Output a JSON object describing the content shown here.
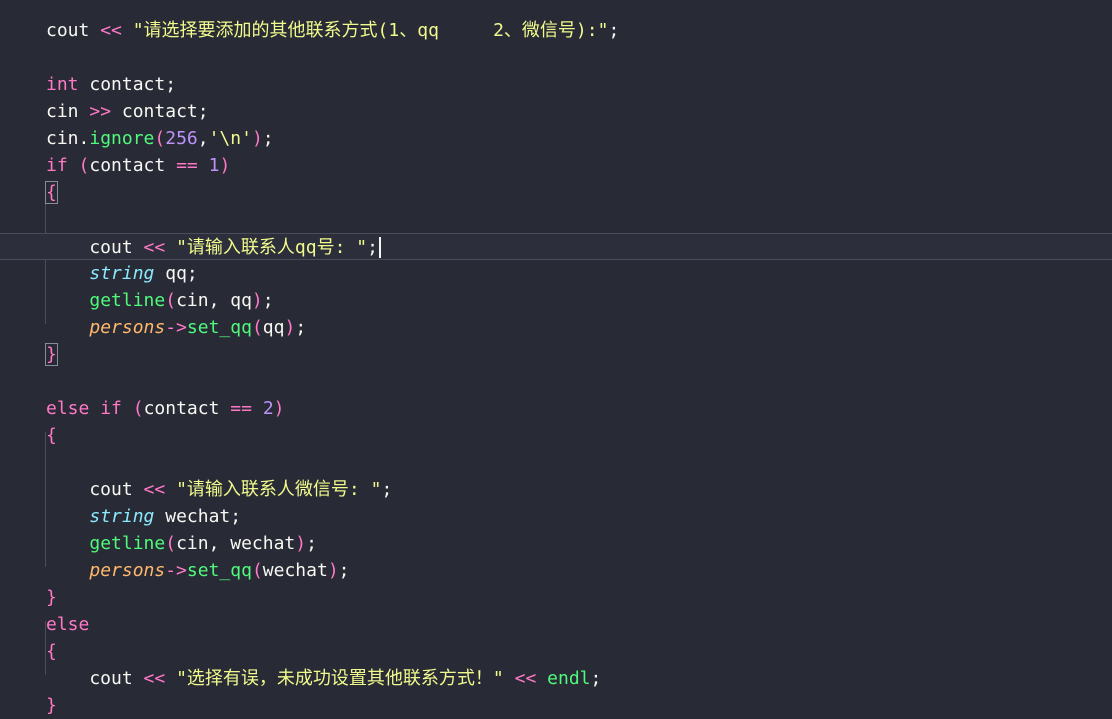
{
  "editor": {
    "theme": "dracula",
    "colors": {
      "background": "#282a36",
      "keyword": "#ff79c6",
      "type": "#8be9fd",
      "string": "#f1fa8c",
      "number": "#bd93f9",
      "function": "#50fa7b",
      "parameter": "#ffb86c",
      "text": "#f8f8f2"
    },
    "current_line": 8,
    "lines": [
      [
        {
          "t": "txt",
          "v": "cout "
        },
        {
          "t": "op",
          "v": "<<"
        },
        {
          "t": "txt",
          "v": " "
        },
        {
          "t": "str",
          "v": "\"请选择要添加的其他联系方式(1、qq     2、微信号):\""
        },
        {
          "t": "txt",
          "v": ";"
        }
      ],
      [],
      [
        {
          "t": "kw",
          "v": "int"
        },
        {
          "t": "txt",
          "v": " contact;"
        }
      ],
      [
        {
          "t": "txt",
          "v": "cin "
        },
        {
          "t": "op",
          "v": ">>"
        },
        {
          "t": "txt",
          "v": " contact;"
        }
      ],
      [
        {
          "t": "txt",
          "v": "cin."
        },
        {
          "t": "fn",
          "v": "ignore"
        },
        {
          "t": "kw",
          "v": "("
        },
        {
          "t": "num",
          "v": "256"
        },
        {
          "t": "txt",
          "v": ","
        },
        {
          "t": "str",
          "v": "'\\n'"
        },
        {
          "t": "kw",
          "v": ")"
        },
        {
          "t": "txt",
          "v": ";"
        }
      ],
      [
        {
          "t": "kw",
          "v": "if"
        },
        {
          "t": "txt",
          "v": " "
        },
        {
          "t": "kw",
          "v": "("
        },
        {
          "t": "txt",
          "v": "contact "
        },
        {
          "t": "op",
          "v": "=="
        },
        {
          "t": "txt",
          "v": " "
        },
        {
          "t": "num",
          "v": "1"
        },
        {
          "t": "kw",
          "v": ")"
        }
      ],
      [
        {
          "t": "kw",
          "v": "{"
        }
      ],
      [],
      [
        {
          "t": "txt",
          "v": "    cout "
        },
        {
          "t": "op",
          "v": "<<"
        },
        {
          "t": "txt",
          "v": " "
        },
        {
          "t": "str",
          "v": "\"请输入联系人qq号: \""
        },
        {
          "t": "txt",
          "v": ";"
        }
      ],
      [
        {
          "t": "txt",
          "v": "    "
        },
        {
          "t": "ty",
          "v": "string"
        },
        {
          "t": "txt",
          "v": " qq;"
        }
      ],
      [
        {
          "t": "txt",
          "v": "    "
        },
        {
          "t": "fn",
          "v": "getline"
        },
        {
          "t": "kw",
          "v": "("
        },
        {
          "t": "txt",
          "v": "cin, qq"
        },
        {
          "t": "kw",
          "v": ")"
        },
        {
          "t": "txt",
          "v": ";"
        }
      ],
      [
        {
          "t": "txt",
          "v": "    "
        },
        {
          "t": "var",
          "v": "persons"
        },
        {
          "t": "op",
          "v": "->"
        },
        {
          "t": "fn",
          "v": "set_qq"
        },
        {
          "t": "kw",
          "v": "("
        },
        {
          "t": "txt",
          "v": "qq"
        },
        {
          "t": "kw",
          "v": ")"
        },
        {
          "t": "txt",
          "v": ";"
        }
      ],
      [
        {
          "t": "kw",
          "v": "}"
        }
      ],
      [],
      [
        {
          "t": "kw",
          "v": "else"
        },
        {
          "t": "txt",
          "v": " "
        },
        {
          "t": "kw",
          "v": "if"
        },
        {
          "t": "txt",
          "v": " "
        },
        {
          "t": "kw",
          "v": "("
        },
        {
          "t": "txt",
          "v": "contact "
        },
        {
          "t": "op",
          "v": "=="
        },
        {
          "t": "txt",
          "v": " "
        },
        {
          "t": "num",
          "v": "2"
        },
        {
          "t": "kw",
          "v": ")"
        }
      ],
      [
        {
          "t": "kw",
          "v": "{"
        }
      ],
      [],
      [
        {
          "t": "txt",
          "v": "    cout "
        },
        {
          "t": "op",
          "v": "<<"
        },
        {
          "t": "txt",
          "v": " "
        },
        {
          "t": "str",
          "v": "\"请输入联系人微信号: \""
        },
        {
          "t": "txt",
          "v": ";"
        }
      ],
      [
        {
          "t": "txt",
          "v": "    "
        },
        {
          "t": "ty",
          "v": "string"
        },
        {
          "t": "txt",
          "v": " wechat;"
        }
      ],
      [
        {
          "t": "txt",
          "v": "    "
        },
        {
          "t": "fn",
          "v": "getline"
        },
        {
          "t": "kw",
          "v": "("
        },
        {
          "t": "txt",
          "v": "cin, wechat"
        },
        {
          "t": "kw",
          "v": ")"
        },
        {
          "t": "txt",
          "v": ";"
        }
      ],
      [
        {
          "t": "txt",
          "v": "    "
        },
        {
          "t": "var",
          "v": "persons"
        },
        {
          "t": "op",
          "v": "->"
        },
        {
          "t": "fn",
          "v": "set_qq"
        },
        {
          "t": "kw",
          "v": "("
        },
        {
          "t": "txt",
          "v": "wechat"
        },
        {
          "t": "kw",
          "v": ")"
        },
        {
          "t": "txt",
          "v": ";"
        }
      ],
      [
        {
          "t": "kw",
          "v": "}"
        }
      ],
      [
        {
          "t": "kw",
          "v": "else"
        }
      ],
      [
        {
          "t": "kw",
          "v": "{"
        }
      ],
      [
        {
          "t": "txt",
          "v": "    cout "
        },
        {
          "t": "op",
          "v": "<<"
        },
        {
          "t": "txt",
          "v": " "
        },
        {
          "t": "str",
          "v": "\"选择有误，未成功设置其他联系方式！\""
        },
        {
          "t": "txt",
          "v": " "
        },
        {
          "t": "op",
          "v": "<<"
        },
        {
          "t": "txt",
          "v": " "
        },
        {
          "t": "fn",
          "v": "endl"
        },
        {
          "t": "txt",
          "v": ";"
        }
      ],
      [
        {
          "t": "kw",
          "v": "}"
        }
      ]
    ]
  }
}
